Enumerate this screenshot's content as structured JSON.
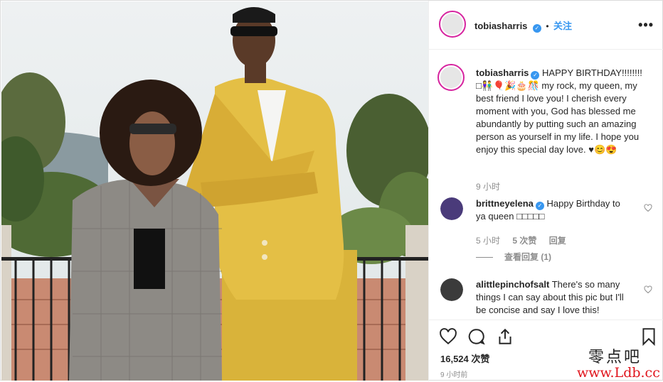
{
  "header": {
    "username": "tobiasharris",
    "verified_icon": "✓",
    "dot": "•",
    "follow_label": "关注",
    "more_icon": "•••"
  },
  "caption": {
    "username": "tobiasharris",
    "text": "HAPPY BIRTHDAY!!!!!!!! □👫🎈🎉🎂🎊 my rock, my queen, my best friend I love you! I cherish every moment with you, God has blessed me abundantly by putting such an amazing person as yourself in my life. I hope you enjoy this special day love. ♥😊😍",
    "time": "9 小时"
  },
  "comments": [
    {
      "username": "brittneyelena",
      "verified": true,
      "text": "Happy Birthday to ya queen □□□□□",
      "time": "5 小时",
      "likes": "5 次赞",
      "reply_label": "回复",
      "view_replies": "查看回复 (1)"
    },
    {
      "username": "alittlepinchofsalt",
      "verified": false,
      "text": "There's so many things I can say about this pic but I'll be concise and say I love this!"
    }
  ],
  "actions": {
    "likes_count": "16,524 次赞",
    "timestamp": "9 小时前"
  },
  "watermark": {
    "line1": "零点吧",
    "line2": "www.Ldb.cc"
  },
  "colors": {
    "accent": "#3897f0",
    "text": "#262626",
    "muted": "#8e8e8e"
  }
}
